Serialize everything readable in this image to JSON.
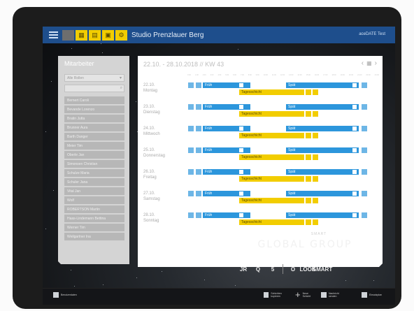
{
  "topbar": {
    "app_title": "Studio Prenzlauer Berg",
    "user_name": "aceDATE Test"
  },
  "left_panel": {
    "title": "Mitarbeiter",
    "role_filter": "Alle Rollen",
    "employees": [
      "Bernert Caroli",
      "Bevande Lorenzo",
      "Bratin Jutta",
      "Brunner Aura",
      "Barth Danger",
      "Meier Tim",
      "Oberle Jan",
      "Simonsen Christian",
      "Schulze Maria",
      "Schuler Jana",
      "Vital Jan",
      "Wolf",
      "ROBERTSON Martin",
      "Haas-Lindemann Bettina",
      "Werner Tim",
      "Weilgartner Ina"
    ]
  },
  "calendar": {
    "range": "22.10. - 28.10.2018 // KW 43",
    "hours": [
      "0:00",
      "1:00",
      "2:00",
      "3:00",
      "4:00",
      "5:00",
      "6:00",
      "7:00",
      "8:00",
      "9:00",
      "10:00",
      "11:00",
      "12:00",
      "13:00",
      "14:00",
      "15:00",
      "16:00",
      "17:00",
      "18:00",
      "19:00",
      "20:00",
      "21:00",
      "22:00",
      "23:00"
    ],
    "days": [
      {
        "date": "22.10.",
        "weekday": "Montag",
        "early": "Früh",
        "late": "Spät",
        "daily": "Tagesschicht"
      },
      {
        "date": "23.10.",
        "weekday": "Dienstag",
        "early": "Früh",
        "late": "Spät",
        "daily": "Tagesschicht"
      },
      {
        "date": "24.10.",
        "weekday": "Mittwoch",
        "early": "Früh",
        "late": "Spät",
        "daily": "Tagesschicht"
      },
      {
        "date": "25.10.",
        "weekday": "Donnerstag",
        "early": "Früh",
        "late": "Spät",
        "daily": "Tagesschicht"
      },
      {
        "date": "26.10.",
        "weekday": "Freitag",
        "early": "Früh",
        "late": "Spät",
        "daily": "Tagesschicht"
      },
      {
        "date": "27.10.",
        "weekday": "Samstag",
        "early": "Früh",
        "late": "Spät",
        "daily": "Tagesschicht"
      },
      {
        "date": "28.10.",
        "weekday": "Sonntag",
        "early": "Früh",
        "late": "Spät",
        "daily": "Tagesschicht"
      }
    ]
  },
  "logo": {
    "small": "SMART",
    "text": "GLOBAL GROUP"
  },
  "brands": [
    "JR",
    "Q",
    "5",
    "O",
    "LOOK",
    "SMART"
  ],
  "bottombar": {
    "left": "Benutzerdaten",
    "b1": "Schichten kopieren",
    "b2": "Neue Schicht",
    "b3": "Nachricht senden",
    "b4": "Einsatzplan"
  },
  "colors": {
    "topbar": "#1e4e8c",
    "shift_blue": "#2c96dc",
    "shift_yellow": "#f2cd00"
  }
}
